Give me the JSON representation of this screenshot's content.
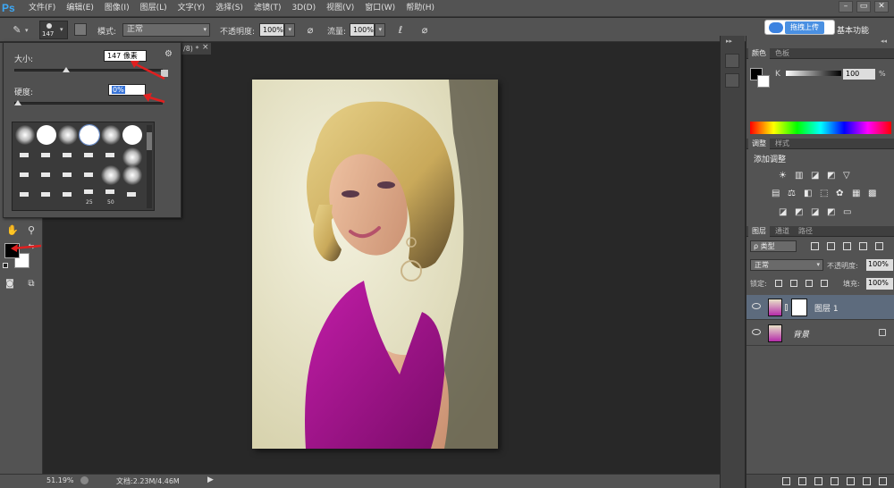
{
  "app": {
    "logo": "Ps"
  },
  "menu": [
    "文件(F)",
    "编辑(E)",
    "图像(I)",
    "图层(L)",
    "文字(Y)",
    "选择(S)",
    "滤镜(T)",
    "3D(D)",
    "视图(V)",
    "窗口(W)",
    "帮助(H)"
  ],
  "window_controls": {
    "minimize": "–",
    "restore": "▭",
    "close": "✕"
  },
  "options": {
    "brush_size": "147",
    "mode_label": "模式:",
    "mode_value": "正常",
    "opacity_label": "不透明度:",
    "opacity_value": "100%",
    "flow_label": "流量:",
    "flow_value": "100%"
  },
  "upload": {
    "label": "拖拽上传"
  },
  "workspace": {
    "label": "基本功能"
  },
  "brush_popup": {
    "size_label": "大小:",
    "size_value": "147 像素",
    "size_fraction": 0.35,
    "hardness_label": "硬度:",
    "hardness_value": "0%",
    "hardness_fraction": 0.0,
    "preset_numbers": [
      "25",
      "50"
    ]
  },
  "document": {
    "tab_title": "/8) *",
    "tab_close": "×"
  },
  "status": {
    "zoom": "51.19%",
    "doc_info": "文档:2.23M/4.46M"
  },
  "color_panel": {
    "tabs": [
      "颜色",
      "色板"
    ],
    "channel": "K",
    "value": "100",
    "percent": "%"
  },
  "adjust_panel": {
    "tabs": [
      "调整",
      "样式"
    ],
    "title": "添加调整"
  },
  "layers_panel": {
    "tabs": [
      "图层",
      "通道",
      "路径"
    ],
    "filter_label": "ρ 类型",
    "blend_mode": "正常",
    "opacity_label": "不透明度:",
    "opacity_value": "100%",
    "lock_label": "锁定:",
    "fill_label": "填充:",
    "fill_value": "100%",
    "layers": [
      {
        "name": "图层 1",
        "selected": true
      },
      {
        "name": "背景",
        "selected": false
      }
    ]
  },
  "colors": {
    "menu_bg": "#535353",
    "canvas_bg": "#282828",
    "accent": "#3da8f5",
    "selected_layer": "#5d6b7d",
    "dress": "#b0189a"
  }
}
